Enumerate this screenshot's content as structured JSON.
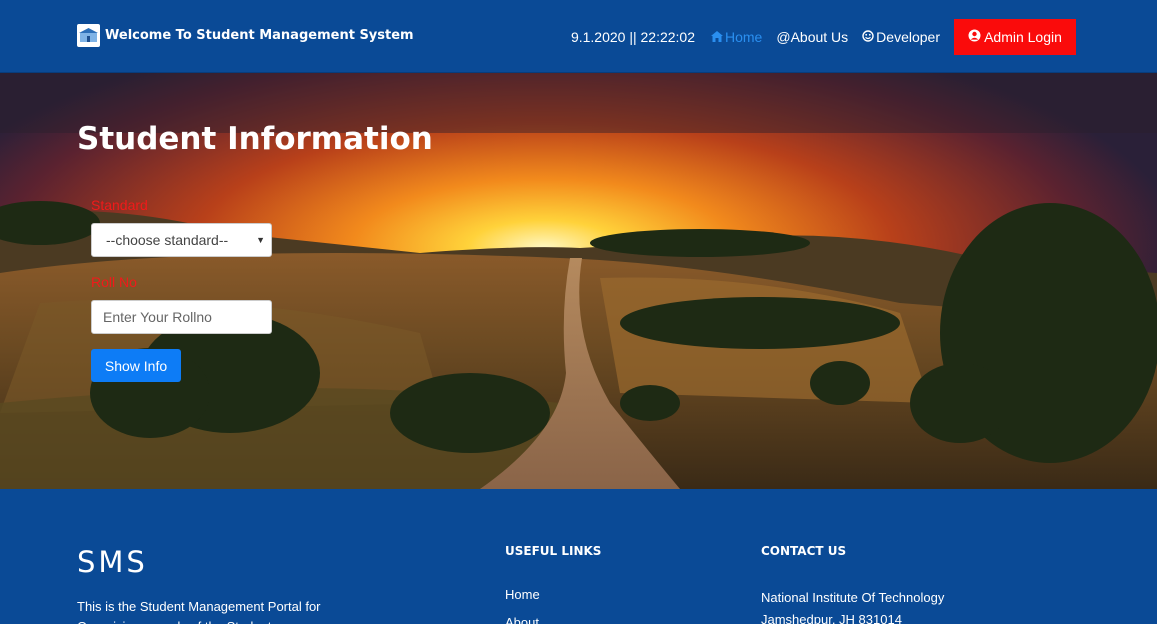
{
  "header": {
    "brand_title": "Welcome To Student Management System",
    "clock": "9.1.2020 || 22:22:02",
    "nav": {
      "home": "Home",
      "about": "@About Us",
      "developer": "Developer",
      "admin_login": "Admin Login"
    }
  },
  "hero": {
    "title": "Student Information",
    "standard_label": "Standard",
    "standard_selected": "--choose standard--",
    "rollno_label": "Roll No",
    "rollno_placeholder": "Enter Your Rollno",
    "show_button": "Show Info"
  },
  "footer": {
    "brand": "SMS",
    "about_text": "This is the Student Management Portal for Organizing records of the Students",
    "useful_links_heading": "USEFUL LINKS",
    "links": [
      "Home",
      "About"
    ],
    "contact_heading": "CONTACT US",
    "contact": [
      "National Institute Of Technology",
      "Jamshedpur, JH 831014"
    ]
  },
  "colors": {
    "nav_bg": "#0a4a96",
    "admin_btn": "#fa0b0b",
    "primary_btn": "#0d7cf6",
    "label_red": "#f01a1a",
    "active_link": "#2a8ff0"
  }
}
